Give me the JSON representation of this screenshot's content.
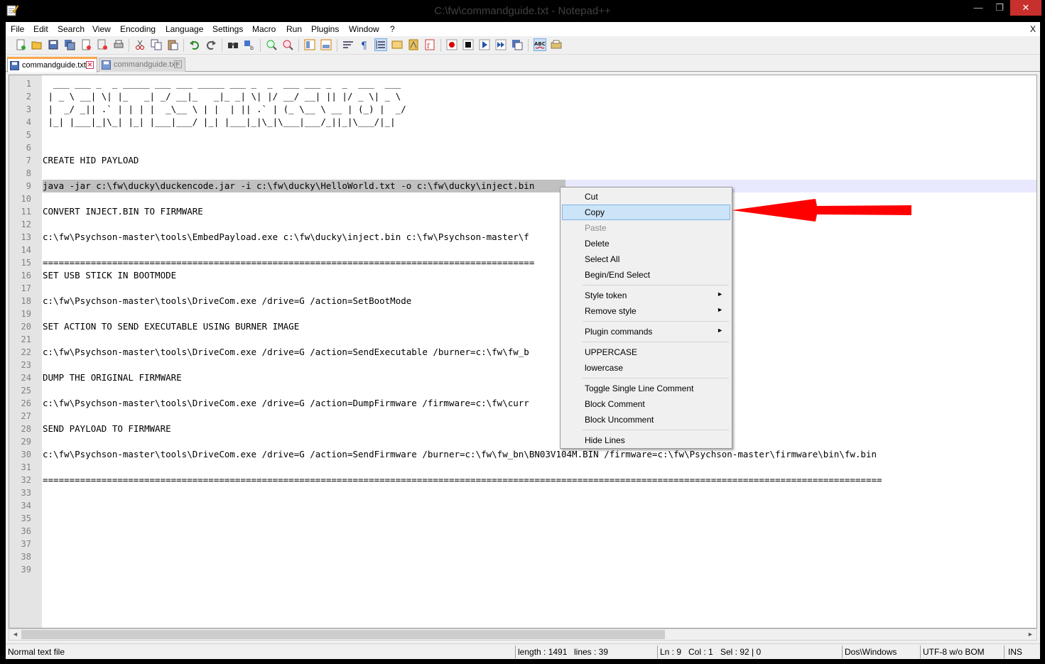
{
  "window": {
    "title": "C:\\fw\\commandguide.txt - Notepad++",
    "minimize": "—",
    "maximize": "❐",
    "close": "✕"
  },
  "menubar": {
    "items": [
      "File",
      "Edit",
      "Search",
      "View",
      "Encoding",
      "Language",
      "Settings",
      "Macro",
      "Run",
      "Plugins",
      "Window",
      "?"
    ],
    "close": "X"
  },
  "tabs": [
    {
      "label": "commandguide.txt",
      "active": true
    },
    {
      "label": "commandguide.txt",
      "active": false
    }
  ],
  "editor": {
    "current_line": 9,
    "lines": [
      "  ___ ___ _  _ _____ ___ ___ _____ ___ _  _  ___ ___ _  _  ___  ___",
      " | _ \\ __| \\| |_   _| _/ __|_   _|_ _| \\| |/ __/ __| || |/ _ \\| _ \\",
      " |  _/ _|| .` | | | |  _\\__ \\ | |  | || .` | (_ \\__ \\ __ | (_) |  _/",
      " |_| |___|_|\\_| |_| |___|___/ |_| |___|_|\\_|\\___|___/_||_|\\___/|_|",
      "",
      "",
      "CREATE HID PAYLOAD",
      "",
      "java -jar c:\\fw\\ducky\\duckencode.jar -i c:\\fw\\ducky\\HelloWorld.txt -o c:\\fw\\ducky\\inject.bin",
      "",
      "CONVERT INJECT.BIN TO FIRMWARE",
      "",
      "c:\\fw\\Psychson-master\\tools\\EmbedPayload.exe c:\\fw\\ducky\\inject.bin c:\\fw\\Psychson-master\\f",
      "",
      "============================================================================================",
      "SET USB STICK IN BOOTMODE",
      "",
      "c:\\fw\\Psychson-master\\tools\\DriveCom.exe /drive=G /action=SetBootMode",
      "",
      "SET ACTION TO SEND EXECUTABLE USING BURNER IMAGE",
      "",
      "c:\\fw\\Psychson-master\\tools\\DriveCom.exe /drive=G /action=SendExecutable /burner=c:\\fw\\fw_b",
      "",
      "DUMP THE ORIGINAL FIRMWARE",
      "",
      "c:\\fw\\Psychson-master\\tools\\DriveCom.exe /drive=G /action=DumpFirmware /firmware=c:\\fw\\curr",
      "",
      "SEND PAYLOAD TO FIRMWARE",
      "",
      "c:\\fw\\Psychson-master\\tools\\DriveCom.exe /drive=G /action=SendFirmware /burner=c:\\fw\\fw_bn\\BN03V104M.BIN /firmware=c:\\fw\\Psychson-master\\firmware\\bin\\fw.bin",
      "",
      "=============================================================================================================================================================",
      "",
      "",
      "",
      "",
      "",
      "",
      ""
    ]
  },
  "context_menu": {
    "items": [
      {
        "label": "Cut",
        "state": "normal"
      },
      {
        "label": "Copy",
        "state": "hover"
      },
      {
        "label": "Paste",
        "state": "disabled"
      },
      {
        "label": "Delete",
        "state": "normal"
      },
      {
        "label": "Select All",
        "state": "normal"
      },
      {
        "label": "Begin/End Select",
        "state": "normal"
      },
      {
        "label": "Style token",
        "state": "normal",
        "submenu": true
      },
      {
        "label": "Remove style",
        "state": "normal",
        "submenu": true
      },
      {
        "label": "Plugin commands",
        "state": "normal",
        "submenu": true
      },
      {
        "label": "UPPERCASE",
        "state": "normal"
      },
      {
        "label": "lowercase",
        "state": "normal"
      },
      {
        "label": "Toggle Single Line Comment",
        "state": "normal"
      },
      {
        "label": "Block Comment",
        "state": "normal"
      },
      {
        "label": "Block Uncomment",
        "state": "normal"
      },
      {
        "label": "Hide Lines",
        "state": "normal"
      }
    ],
    "submenu_arrow": "►"
  },
  "statusbar": {
    "file_type": "Normal text file",
    "length": "length : 1491",
    "lines": "lines : 39",
    "ln": "Ln : 9",
    "col": "Col : 1",
    "sel": "Sel : 92 | 0",
    "eol": "Dos\\Windows",
    "encoding": "UTF-8 w/o BOM",
    "mode": "INS"
  },
  "colors": {
    "annotation_arrow": "#ff0000",
    "menu_hover": "#cce4f7",
    "tab_accent": "#f9a64a"
  }
}
